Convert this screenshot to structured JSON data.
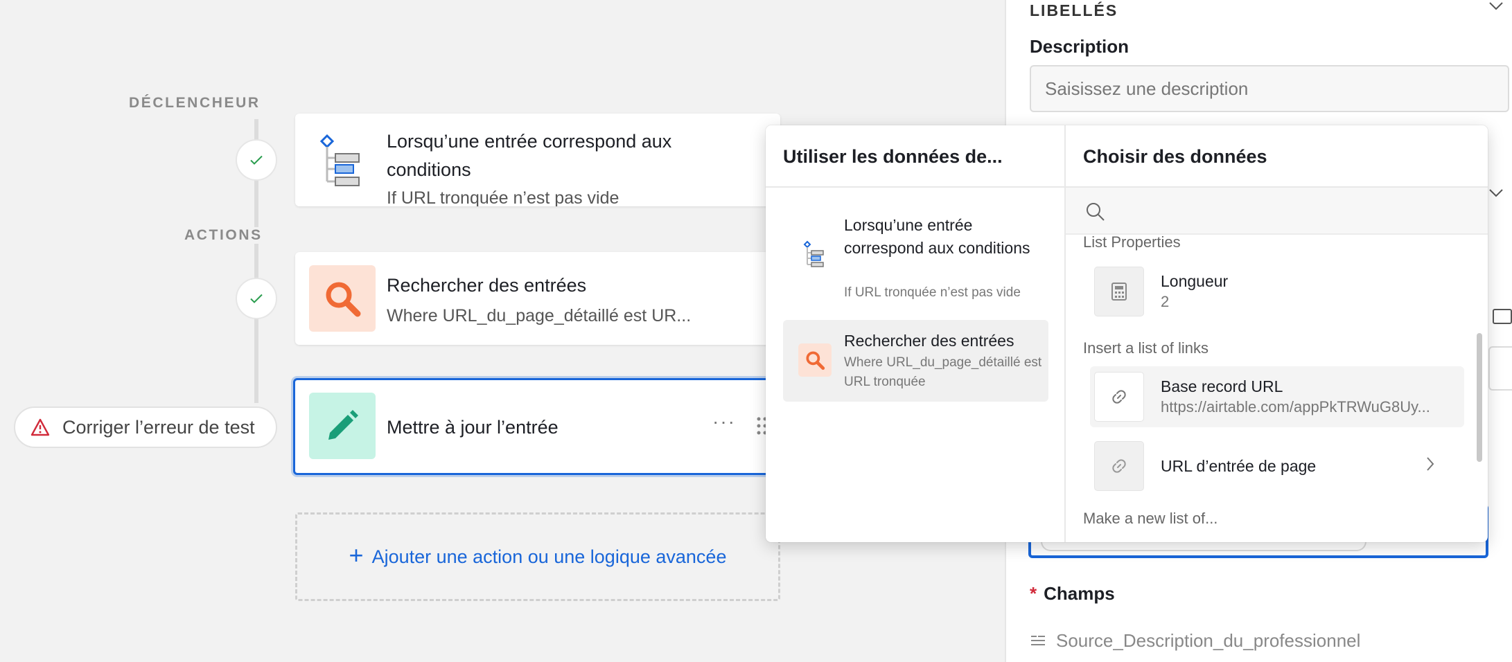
{
  "canvas": {
    "trigger_label": "DÉCLENCHEUR",
    "actions_label": "ACTIONS",
    "trigger_card": {
      "title_line1": "Lorsqu’une entrée correspond aux",
      "title_line2": "conditions",
      "subtitle": "If URL tronquée n’est pas vide"
    },
    "search_card": {
      "title": "Rechercher des entrées",
      "subtitle": "Where URL_du_page_détaillé est UR..."
    },
    "update_card": {
      "title": "Mettre à jour l’entrée",
      "more": "···"
    },
    "error_button": "Corriger l’erreur de test",
    "add_action": "Ajouter une action ou une logique avancée"
  },
  "right_panel": {
    "section_title": "LIBELLÉS",
    "description_label": "Description",
    "description_placeholder": "Saisissez une description",
    "champs_required": "*",
    "champs_label": "Champs",
    "source_field": "Source_Description_du_professionnel"
  },
  "popover": {
    "left_header": "Utiliser les données de...",
    "right_header": "Choisir des données",
    "sources": [
      {
        "title": "Lorsqu’une entrée correspond aux conditions",
        "subtitle": "If URL tronquée n’est pas vide",
        "icon": "condition-icon"
      },
      {
        "title": "Rechercher des entrées",
        "subtitle": "Where URL_du_page_détaillé est URL tronquée",
        "icon": "search-icon"
      }
    ],
    "search_placeholder": "",
    "groups": {
      "list_properties": "List Properties",
      "insert_links": "Insert a list of links",
      "make_new": "Make a new list of..."
    },
    "items": {
      "length": {
        "title": "Longueur",
        "value": "2"
      },
      "base_url": {
        "title": "Base record URL",
        "value": "https://airtable.com/appPkTRWuG8Uy..."
      },
      "page_url": {
        "title": "URL d’entrée de page"
      }
    }
  },
  "colors": {
    "accent": "#1966d9",
    "search_icon_bg": "#fde2d6",
    "search_icon_fg": "#f06a35",
    "edit_icon_bg": "#c6f3e5",
    "edit_icon_fg": "#1a9e78",
    "error": "#d12a3a",
    "check": "#2a9d4e"
  }
}
